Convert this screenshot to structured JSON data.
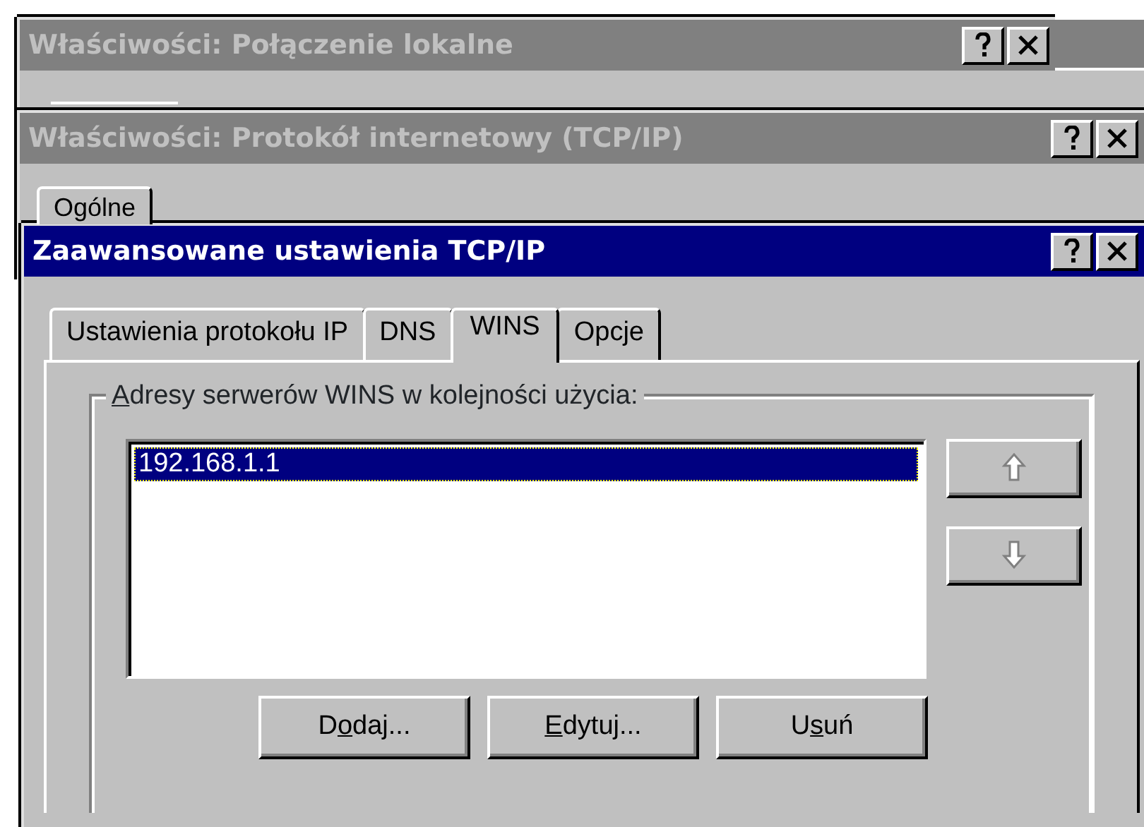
{
  "windows": [
    {
      "title": "Właściwości: Połączenie lokalne",
      "active": false
    },
    {
      "title": "Właściwości: Protokół internetowy (TCP/IP)",
      "active": false,
      "tabs": [
        {
          "label": "Ogólne",
          "selected": true
        }
      ]
    },
    {
      "title": "Zaawansowane ustawienia TCP/IP",
      "active": true
    }
  ],
  "tabs": [
    {
      "label": "Ustawienia protokołu IP",
      "selected": false
    },
    {
      "label": "DNS",
      "selected": false
    },
    {
      "label": "WINS",
      "selected": true
    },
    {
      "label": "Opcje",
      "selected": false
    }
  ],
  "group": {
    "label_parts": [
      {
        "text": "A",
        "underlined": true
      },
      {
        "text": "dresy serwerów WINS w kolejności użycia:",
        "underlined": false
      }
    ]
  },
  "servers": [
    {
      "address": "192.168.1.1",
      "selected": true
    }
  ],
  "move_buttons": [
    {
      "kind": "up",
      "disabled": true
    },
    {
      "kind": "down",
      "disabled": true
    }
  ],
  "buttons": [
    {
      "label_parts": [
        {
          "text": "D",
          "underlined": false
        },
        {
          "text": "o",
          "underlined": true
        },
        {
          "text": "daj...",
          "underlined": false
        }
      ]
    },
    {
      "label_parts": [
        {
          "text": "E",
          "underlined": true
        },
        {
          "text": "dytuj...",
          "underlined": false
        }
      ]
    },
    {
      "label_parts": [
        {
          "text": "U",
          "underlined": false
        },
        {
          "text": "s",
          "underlined": true
        },
        {
          "text": "uń",
          "underlined": false
        }
      ]
    }
  ]
}
